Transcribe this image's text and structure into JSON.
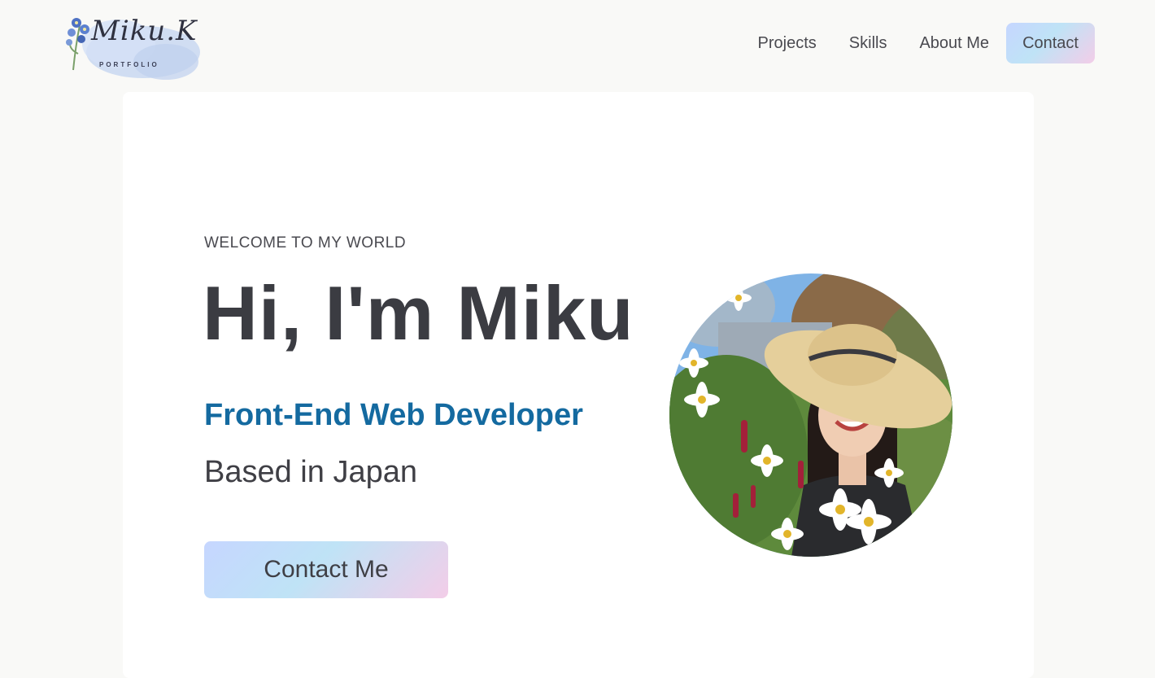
{
  "header": {
    "logo": {
      "script_text": "Miku.K",
      "subtitle": "PORTFOLIO"
    },
    "nav": [
      {
        "label": "Projects"
      },
      {
        "label": "Skills"
      },
      {
        "label": "About Me"
      }
    ],
    "nav_cta": "Contact"
  },
  "hero": {
    "eyebrow": "WELCOME TO MY WORLD",
    "headline": "Hi, I'm Miku",
    "role": "Front-End Web Developer",
    "location": "Based in Japan",
    "cta_label": "Contact Me"
  },
  "colors": {
    "background": "#f9f9f7",
    "card": "#ffffff",
    "role_accent": "#146aa0",
    "text": "#3b3c42",
    "gradient_start": "#c6d6ff",
    "gradient_mid": "#bfe3f6",
    "gradient_end": "#f3cde8"
  }
}
